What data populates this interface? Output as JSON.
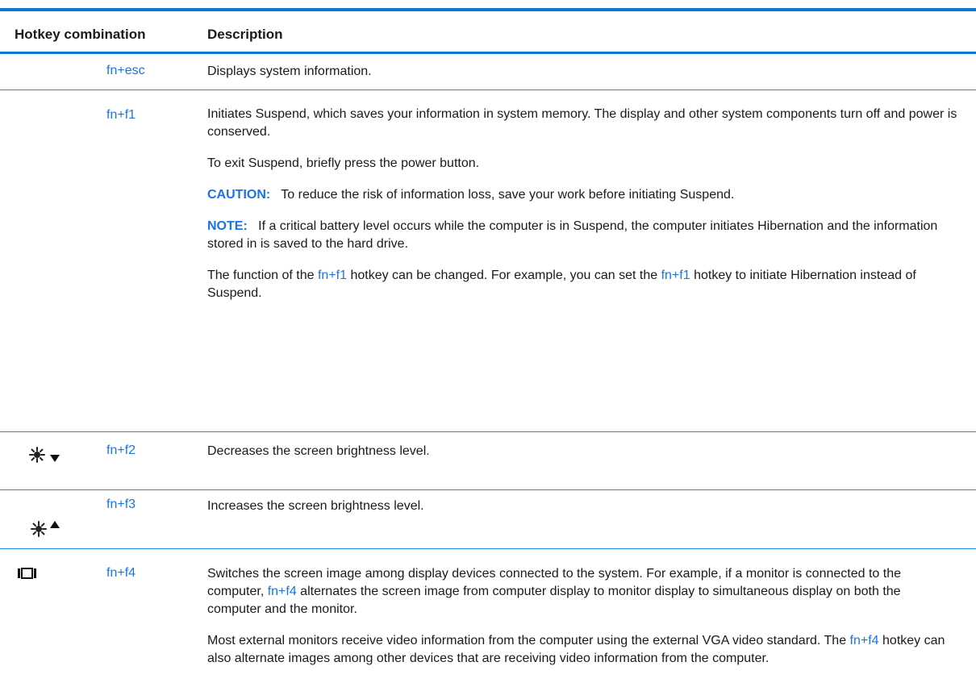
{
  "table": {
    "header": {
      "col1": "Hotkey combination",
      "col2": "Description"
    },
    "row_esc": {
      "key": "fn+esc",
      "desc": "Displays system information."
    },
    "row_f1": {
      "key": "fn+f1",
      "p1": "Initiates Suspend, which saves your information in system memory. The display and other system components turn off and power is conserved.",
      "p2": "To exit Suspend, briefly press the power button.",
      "caution_label": "CAUTION:",
      "caution_text": "To reduce the risk of information loss, save your work before initiating Suspend.",
      "note_label": "NOTE:",
      "note_text": "If a critical battery level occurs while the computer is in Suspend, the computer initiates Hibernation and the information stored in is saved to the hard drive.",
      "p5_a": "The function of the ",
      "p5_link1": "fn+f1",
      "p5_b": " hotkey can be changed. For example, you can set the ",
      "p5_link2": "fn+f1",
      "p5_c": " hotkey to initiate Hibernation instead of Suspend."
    },
    "row_f2": {
      "key": "fn+f2",
      "desc": "Decreases the screen brightness level."
    },
    "row_f3": {
      "key": "fn+f3",
      "desc": "Increases the screen brightness level."
    },
    "row_f4": {
      "key": "fn+f4",
      "p1_a": "Switches the screen image among display devices connected to the system. For example, if a monitor is connected to the computer, ",
      "p1_link": "fn+f4",
      "p1_b": " alternates the screen image from computer display to monitor display to simultaneous display on both the computer and the monitor.",
      "p2_a": "Most external monitors receive video information from the computer using the external VGA video standard. The ",
      "p2_link": "fn+f4",
      "p2_b": " hotkey can also alternate images among other devices that are receiving video information from the computer."
    }
  },
  "icons": {
    "row_f1": "moon-icon",
    "row_f2": "brightness-down-icon",
    "row_f3": "brightness-up-icon",
    "row_f4": "display-switch-icon"
  },
  "colors": {
    "accent": "#0a78d7",
    "link": "#1a73e8"
  }
}
